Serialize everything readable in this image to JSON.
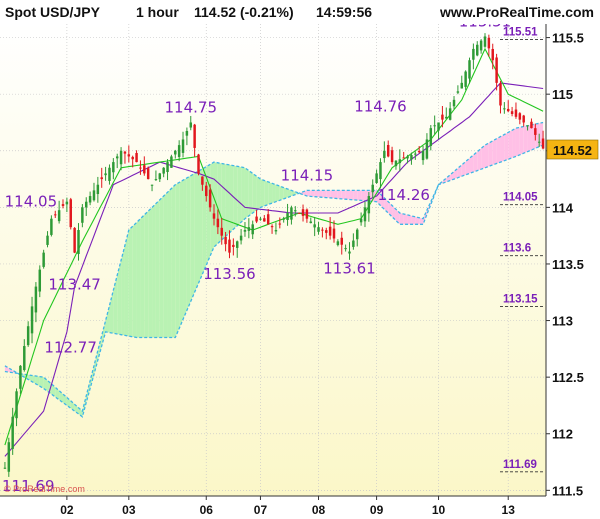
{
  "header": {
    "instrument": "Spot USD/JPY",
    "timeframe": "1 hour",
    "last_change": "114.52 (-0.21%)",
    "time": "14:59:56",
    "site": "www.ProRealTime.com"
  },
  "watermark": "© ProRealTime.com",
  "price_badge": "114.52",
  "colors": {
    "background_top": "#ffffff",
    "background_bottom": "#fbf7c8",
    "bull_candle": "#2e9a36",
    "bear_candle": "#e2171e",
    "fast_line": "#22c61f",
    "slow_line": "#7a1fb8",
    "cloud_bull": "#b9f2b3",
    "cloud_bear": "#ffc0e6",
    "span_dotted": "#3fb6e6",
    "badge": "#f5b412",
    "annotation": "#7a1fb8"
  },
  "chart_data": {
    "type": "candlestick",
    "ylim": [
      111.45,
      115.62
    ],
    "yticks": [
      "115.5",
      "115",
      "114.5",
      "114",
      "113.5",
      "113",
      "112.5",
      "112",
      "111.5"
    ],
    "ytick_values": [
      115.5,
      115,
      114.5,
      114,
      113.5,
      113,
      112.5,
      112,
      111.5
    ],
    "xtick_labels": [
      "02",
      "03",
      "06",
      "07",
      "08",
      "09",
      "10",
      "13"
    ],
    "bar_count": 140,
    "xtick_bar_index": [
      16,
      32,
      52,
      66,
      81,
      96,
      112,
      130
    ],
    "close_path": [
      [
        0,
        111.7
      ],
      [
        4,
        112.6
      ],
      [
        8,
        113.3
      ],
      [
        12,
        113.9
      ],
      [
        16,
        114.05
      ],
      [
        18,
        113.6
      ],
      [
        20,
        114.0
      ],
      [
        26,
        114.3
      ],
      [
        30,
        114.5
      ],
      [
        34,
        114.4
      ],
      [
        38,
        114.2
      ],
      [
        42,
        114.4
      ],
      [
        46,
        114.6
      ],
      [
        48,
        114.75
      ],
      [
        50,
        114.3
      ],
      [
        54,
        113.9
      ],
      [
        58,
        113.6
      ],
      [
        62,
        113.8
      ],
      [
        66,
        113.9
      ],
      [
        70,
        113.8
      ],
      [
        74,
        114.0
      ],
      [
        78,
        113.9
      ],
      [
        82,
        113.8
      ],
      [
        86,
        113.7
      ],
      [
        89,
        113.61
      ],
      [
        92,
        113.9
      ],
      [
        95,
        114.2
      ],
      [
        98,
        114.5
      ],
      [
        100,
        114.4
      ],
      [
        104,
        114.45
      ],
      [
        108,
        114.5
      ],
      [
        110,
        114.7
      ],
      [
        114,
        114.8
      ],
      [
        118,
        115.1
      ],
      [
        121,
        115.4
      ],
      [
        124,
        115.51
      ],
      [
        126,
        115.3
      ],
      [
        128,
        114.9
      ],
      [
        132,
        114.8
      ],
      [
        136,
        114.7
      ],
      [
        139,
        114.52
      ]
    ],
    "series": [
      {
        "name": "",
        "values": [
          [
            0,
            111.9
          ],
          [
            10,
            113.0
          ],
          [
            20,
            113.7
          ],
          [
            30,
            114.35
          ],
          [
            40,
            114.4
          ],
          [
            50,
            114.45
          ],
          [
            56,
            113.9
          ],
          [
            64,
            113.8
          ],
          [
            76,
            113.95
          ],
          [
            86,
            113.85
          ],
          [
            92,
            113.9
          ],
          [
            100,
            114.35
          ],
          [
            110,
            114.6
          ],
          [
            118,
            114.95
          ],
          [
            124,
            115.4
          ],
          [
            130,
            115.0
          ],
          [
            139,
            114.85
          ]
        ]
      },
      {
        "name": "",
        "values": [
          [
            0,
            111.8
          ],
          [
            10,
            112.2
          ],
          [
            16,
            112.9
          ],
          [
            18,
            113.3
          ],
          [
            28,
            114.2
          ],
          [
            40,
            114.4
          ],
          [
            50,
            114.3
          ],
          [
            54,
            114.25
          ],
          [
            62,
            114.0
          ],
          [
            74,
            113.95
          ],
          [
            86,
            113.95
          ],
          [
            96,
            114.1
          ],
          [
            104,
            114.4
          ],
          [
            112,
            114.6
          ],
          [
            120,
            114.8
          ],
          [
            128,
            115.1
          ],
          [
            139,
            115.05
          ]
        ]
      },
      {
        "name": "",
        "values": [
          [
            0,
            112.55
          ],
          [
            10,
            112.5
          ],
          [
            20,
            112.2
          ],
          [
            26,
            113.0
          ],
          [
            32,
            113.8
          ],
          [
            44,
            114.2
          ],
          [
            54,
            114.4
          ],
          [
            62,
            114.35
          ],
          [
            66,
            114.25
          ],
          [
            78,
            114.1
          ],
          [
            96,
            114.05
          ],
          [
            102,
            113.85
          ],
          [
            108,
            113.85
          ],
          [
            112,
            114.2
          ],
          [
            124,
            114.35
          ],
          [
            132,
            114.45
          ],
          [
            139,
            114.55
          ]
        ]
      },
      {
        "name": "",
        "values": [
          [
            0,
            112.6
          ],
          [
            10,
            112.4
          ],
          [
            20,
            112.15
          ],
          [
            26,
            112.9
          ],
          [
            34,
            112.85
          ],
          [
            44,
            112.85
          ],
          [
            54,
            113.65
          ],
          [
            62,
            113.9
          ],
          [
            66,
            114.0
          ],
          [
            78,
            114.15
          ],
          [
            96,
            114.15
          ],
          [
            102,
            113.95
          ],
          [
            108,
            113.9
          ],
          [
            112,
            114.2
          ],
          [
            124,
            114.55
          ],
          [
            132,
            114.7
          ],
          [
            139,
            114.75
          ]
        ]
      }
    ],
    "annotations": [
      {
        "label": "115.51",
        "bar": 124,
        "value": 115.51,
        "pos": "above"
      },
      {
        "label": "114.75",
        "bar": 48,
        "value": 114.75,
        "pos": "above"
      },
      {
        "label": "114.76",
        "bar": 97,
        "value": 114.76,
        "pos": "above"
      },
      {
        "label": "114.05",
        "bar": 16,
        "value": 114.05,
        "pos": "left"
      },
      {
        "label": "114.15",
        "bar": 78,
        "value": 114.15,
        "pos": "above"
      },
      {
        "label": "114.26",
        "bar": 103,
        "value": 114.26,
        "pos": "below"
      },
      {
        "label": "113.47",
        "bar": 18,
        "value": 113.47,
        "pos": "below"
      },
      {
        "label": "113.56",
        "bar": 58,
        "value": 113.56,
        "pos": "below"
      },
      {
        "label": "113.61",
        "bar": 89,
        "value": 113.61,
        "pos": "below"
      },
      {
        "label": "112.77",
        "bar": 4,
        "value": 112.77,
        "pos": "right"
      },
      {
        "label": "111.69",
        "bar": 0,
        "value": 111.69,
        "pos": "below"
      }
    ],
    "levels": [
      {
        "label": "115.51",
        "value": 115.51
      },
      {
        "label": "114.05",
        "value": 114.05
      },
      {
        "label": "113.6",
        "value": 113.6
      },
      {
        "label": "113.15",
        "value": 113.15
      },
      {
        "label": "111.69",
        "value": 111.69
      }
    ]
  }
}
